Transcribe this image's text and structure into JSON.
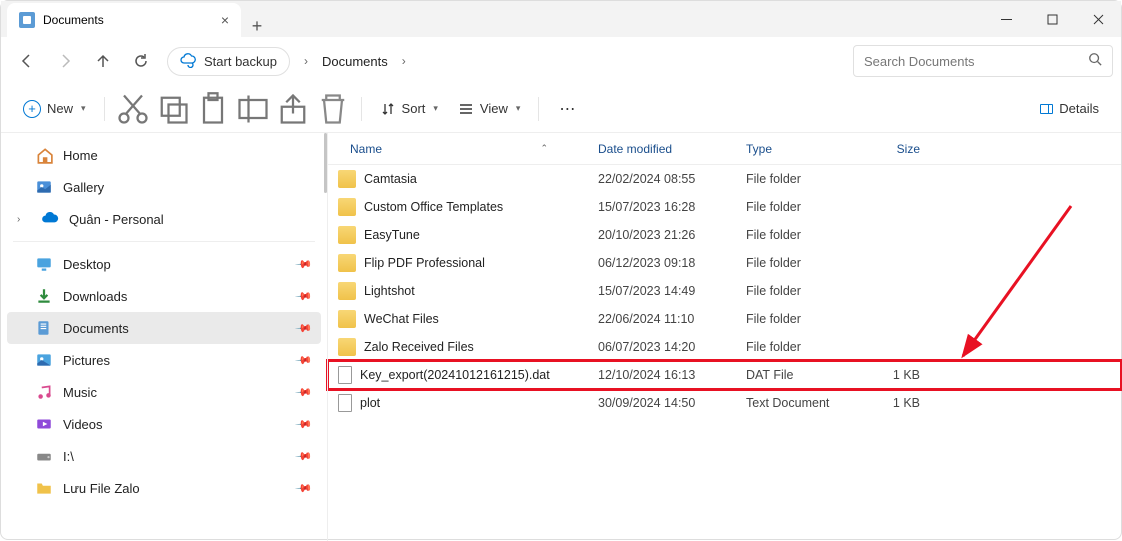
{
  "titlebar": {
    "tab_title": "Documents"
  },
  "breadcrumb": {
    "pill_label": "Start backup",
    "items": [
      "Documents"
    ]
  },
  "search": {
    "placeholder": "Search Documents"
  },
  "toolbar": {
    "new_label": "New",
    "sort_label": "Sort",
    "view_label": "View",
    "details_label": "Details"
  },
  "sidebar": {
    "top": [
      {
        "label": "Home",
        "icon": "home"
      },
      {
        "label": "Gallery",
        "icon": "gallery"
      },
      {
        "label": "Quân - Personal",
        "icon": "onedrive",
        "expandable": true
      }
    ],
    "quick": [
      {
        "label": "Desktop",
        "icon": "desktop"
      },
      {
        "label": "Downloads",
        "icon": "downloads"
      },
      {
        "label": "Documents",
        "icon": "documents",
        "selected": true
      },
      {
        "label": "Pictures",
        "icon": "pictures"
      },
      {
        "label": "Music",
        "icon": "music"
      },
      {
        "label": "Videos",
        "icon": "videos"
      },
      {
        "label": "I:\\",
        "icon": "drive"
      },
      {
        "label": "Lưu File Zalo",
        "icon": "folder"
      }
    ]
  },
  "columns": {
    "name": "Name",
    "date": "Date modified",
    "type": "Type",
    "size": "Size"
  },
  "files": [
    {
      "name": "Camtasia",
      "date": "22/02/2024 08:55",
      "type": "File folder",
      "size": "",
      "kind": "folder"
    },
    {
      "name": "Custom Office Templates",
      "date": "15/07/2023 16:28",
      "type": "File folder",
      "size": "",
      "kind": "folder"
    },
    {
      "name": "EasyTune",
      "date": "20/10/2023 21:26",
      "type": "File folder",
      "size": "",
      "kind": "folder"
    },
    {
      "name": "Flip PDF Professional",
      "date": "06/12/2023 09:18",
      "type": "File folder",
      "size": "",
      "kind": "folder"
    },
    {
      "name": "Lightshot",
      "date": "15/07/2023 14:49",
      "type": "File folder",
      "size": "",
      "kind": "folder"
    },
    {
      "name": "WeChat Files",
      "date": "22/06/2024 11:10",
      "type": "File folder",
      "size": "",
      "kind": "folder"
    },
    {
      "name": "Zalo Received Files",
      "date": "06/07/2023 14:20",
      "type": "File folder",
      "size": "",
      "kind": "folder"
    },
    {
      "name": "Key_export(20241012161215).dat",
      "date": "12/10/2024 16:13",
      "type": "DAT File",
      "size": "1 KB",
      "kind": "file",
      "highlight": true
    },
    {
      "name": "plot",
      "date": "30/09/2024 14:50",
      "type": "Text Document",
      "size": "1 KB",
      "kind": "file"
    }
  ]
}
